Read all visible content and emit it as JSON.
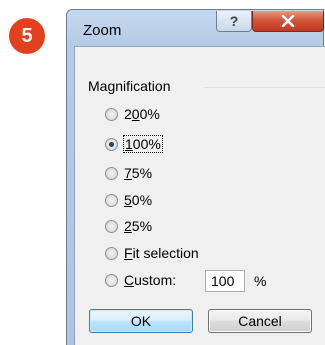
{
  "step_badge": "5",
  "colors": {
    "badge": "#e2401e",
    "close_button": "#c13a20",
    "frame": "#b6cbe5",
    "client_bg": "#f0f0f0"
  },
  "dialog": {
    "title": "Zoom",
    "help_icon": "question-mark-icon",
    "close_icon": "x-icon",
    "group_label": "Magnification",
    "options": [
      {
        "pre": "2",
        "u": "0",
        "post": "0%",
        "checked": false
      },
      {
        "pre": "",
        "u": "1",
        "post": "00%",
        "checked": true
      },
      {
        "pre": "",
        "u": "7",
        "post": "5%",
        "checked": false
      },
      {
        "pre": "",
        "u": "5",
        "post": "0%",
        "checked": false
      },
      {
        "pre": "",
        "u": "2",
        "post": "5%",
        "checked": false
      },
      {
        "pre": "",
        "u": "F",
        "post": "it selection",
        "checked": false
      },
      {
        "pre": "",
        "u": "C",
        "post": "ustom:",
        "checked": false
      }
    ],
    "custom_value": "100",
    "percent_label": "%",
    "ok_label": "OK",
    "cancel_label": "Cancel"
  }
}
